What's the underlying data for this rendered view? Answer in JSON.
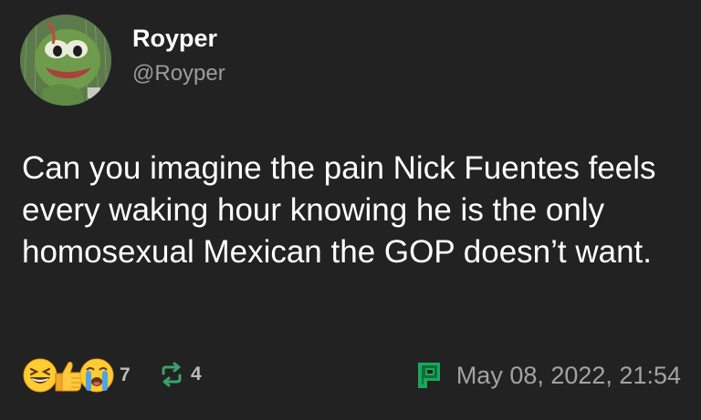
{
  "author": {
    "display_name": "Royper",
    "handle": "@Royper",
    "avatar_icon": "pepe-frog-avatar"
  },
  "post": {
    "text": "Can you imagine the pain Nick Fuentes feels every waking hour knowing he is the only homosexual Mexican the GOP doesn’t want."
  },
  "reactions": {
    "emojis": [
      "grinning-squinting-face-icon",
      "thumbs-up-icon",
      "loudly-crying-face-icon"
    ],
    "count": "7"
  },
  "boosts": {
    "icon": "repost-icon",
    "count": "4"
  },
  "meta": {
    "client_icon": "pleroma-icon",
    "timestamp": "May 08, 2022, 21:54"
  },
  "colors": {
    "background": "#222222",
    "text": "#ffffff",
    "muted": "#9c9c9c",
    "boost_green": "#38a36b",
    "client_green": "#19a85a"
  }
}
